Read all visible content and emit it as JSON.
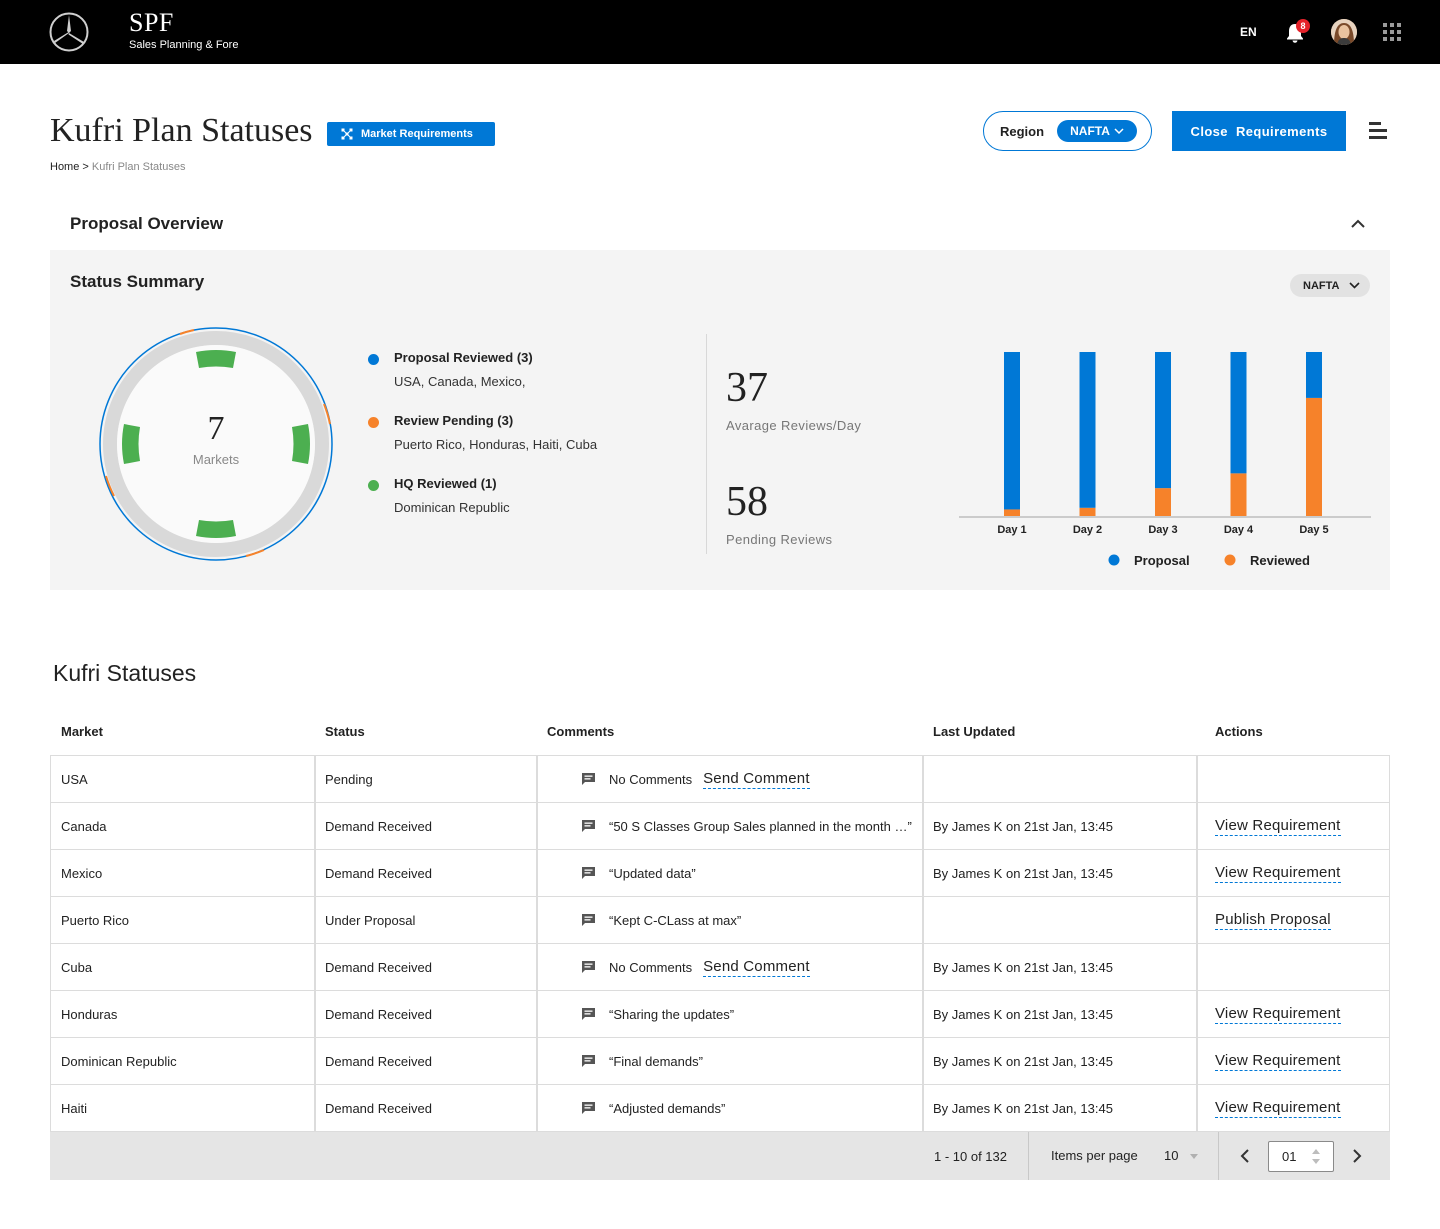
{
  "header": {
    "app_name": "SPF",
    "app_subtitle": "Sales Planning & Fore",
    "language": "EN",
    "notification_count": "8",
    "icons": [
      "mercedes-star-logo",
      "bell-icon",
      "avatar",
      "apps-grid-icon"
    ]
  },
  "page": {
    "title": "Kufri Plan Statuses",
    "market_requirements_label": "Market Requirements",
    "breadcrumb_home": "Home",
    "breadcrumb_sep": " > ",
    "breadcrumb_current": "Kufri Plan Statuses",
    "region_label": "Region",
    "region_value": "NAFTA",
    "close_requirements_label": "Close  Requirements"
  },
  "overview": {
    "title": "Proposal Overview",
    "status_summary_title": "Status Summary",
    "region_filter": "NAFTA",
    "donut_value": "7",
    "donut_label": "Markets",
    "legend": [
      {
        "title": "Proposal Reviewed (3)",
        "sub": "USA, Canada, Mexico,",
        "color": "#0078d6"
      },
      {
        "title": "Review Pending (3)",
        "sub": "Puerto Rico, Honduras, Haiti, Cuba",
        "color": "#f6822a"
      },
      {
        "title": "HQ Reviewed (1)",
        "sub": "Dominican Republic",
        "color": "#4caf50"
      }
    ],
    "metrics": [
      {
        "value": "37",
        "label": "Avarage Reviews/Day"
      },
      {
        "value": "58",
        "label": "Pending Reviews"
      }
    ]
  },
  "chart_data": {
    "type": "bar",
    "stacked": true,
    "categories": [
      "Day 1",
      "Day 2",
      "Day 3",
      "Day 4",
      "Day 5"
    ],
    "series": [
      {
        "name": "Proposal",
        "color": "#0078d6",
        "values": [
          96,
          95,
          83,
          74,
          28
        ]
      },
      {
        "name": "Reviewed",
        "color": "#f6822a",
        "values": [
          4,
          5,
          17,
          26,
          72
        ]
      }
    ],
    "ylim": [
      0,
      100
    ],
    "legend_position": "bottom"
  },
  "statuses": {
    "title": "Kufri Statuses",
    "columns": [
      "Market",
      "Status",
      "Comments",
      "Last Updated",
      "Actions"
    ],
    "rows": [
      {
        "market": "USA",
        "status": "Pending",
        "comment": "No Comments",
        "comment_link": "Send Comment",
        "updated": "",
        "action": ""
      },
      {
        "market": "Canada",
        "status": "Demand Received",
        "comment": "“50 S Classes Group Sales planned in the month …”",
        "comment_link": "",
        "updated": "By James K on 21st Jan, 13:45",
        "action": "View Requirement"
      },
      {
        "market": "Mexico",
        "status": "Demand Received",
        "comment": "“Updated data”",
        "comment_link": "",
        "updated": "By James K on 21st Jan, 13:45",
        "action": "View Requirement"
      },
      {
        "market": "Puerto Rico",
        "status": "Under Proposal",
        "comment": "“Kept C-CLass at max”",
        "comment_link": "",
        "updated": "",
        "action": "Publish Proposal"
      },
      {
        "market": "Cuba",
        "status": "Demand Received",
        "comment": "No Comments",
        "comment_link": "Send Comment",
        "updated": "By James K on 21st Jan, 13:45",
        "action": ""
      },
      {
        "market": "Honduras",
        "status": "Demand Received",
        "comment": "“Sharing the updates”",
        "comment_link": "",
        "updated": "By James K on 21st Jan, 13:45",
        "action": "View Requirement"
      },
      {
        "market": "Dominican Republic",
        "status": "Demand Received",
        "comment": "“Final demands”",
        "comment_link": "",
        "updated": "By James K on 21st Jan, 13:45",
        "action": "View Requirement"
      },
      {
        "market": "Haiti",
        "status": "Demand Received",
        "comment": "“Adjusted demands”",
        "comment_link": "",
        "updated": "By James K on 21st Jan, 13:45",
        "action": "View Requirement"
      }
    ]
  },
  "pagination": {
    "range": "1 - 10 of 132",
    "items_per_page_label": "Items per page",
    "items_per_page": "10",
    "page": "01"
  }
}
